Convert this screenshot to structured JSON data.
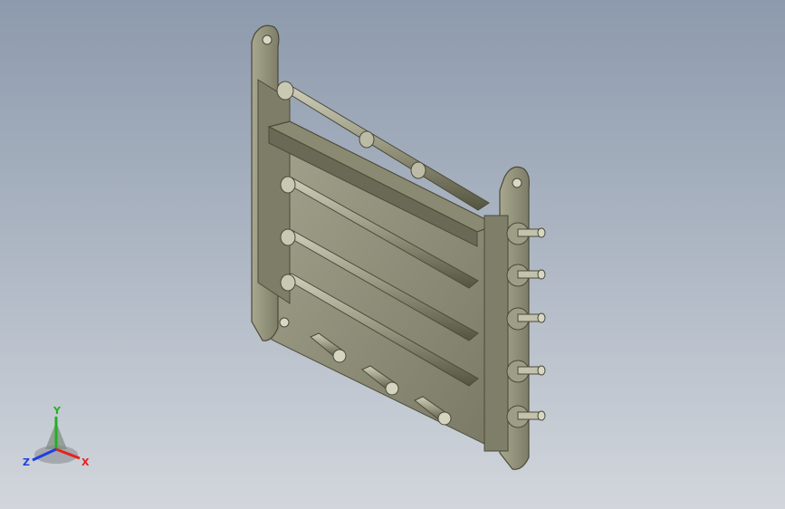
{
  "viewport": {
    "background_top": "#8d9aad",
    "background_bottom": "#d2d6dc",
    "model_color": "#8f8e77",
    "model_shadow": "#5e5c4a",
    "model_highlight": "#b6b59e"
  },
  "triad": {
    "x_label": "X",
    "y_label": "Y",
    "z_label": "Z",
    "x_color": "#e8201c",
    "y_color": "#23b023",
    "z_color": "#1d3fe0"
  }
}
